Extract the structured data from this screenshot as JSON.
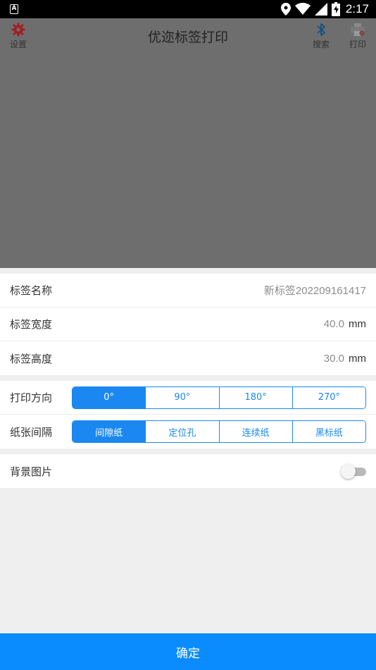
{
  "status": {
    "time": "2:17",
    "app_icon": "A"
  },
  "appbar": {
    "title": "优迩标签打印",
    "settings_label": "设置",
    "search_label": "搜索",
    "print_label": "打印"
  },
  "form": {
    "label_name": {
      "label": "标签名称",
      "value": "新标签202209161417"
    },
    "label_width": {
      "label": "标签宽度",
      "value": "40.0",
      "unit": "mm"
    },
    "label_height": {
      "label": "标签高度",
      "value": "30.0",
      "unit": "mm"
    },
    "print_direction": {
      "label": "打印方向",
      "options": [
        "0°",
        "90°",
        "180°",
        "270°"
      ],
      "selected": "0°"
    },
    "paper_gap": {
      "label": "纸张间隔",
      "options": [
        "间隙纸",
        "定位孔",
        "连续纸",
        "黑标纸"
      ],
      "selected": "间隙纸"
    },
    "background_image": {
      "label": "背景图片",
      "enabled": false
    }
  },
  "confirm_label": "确定",
  "colors": {
    "accent": "#1a88f0",
    "button": "#0a8cff",
    "overlay": "#6e6e6e"
  }
}
